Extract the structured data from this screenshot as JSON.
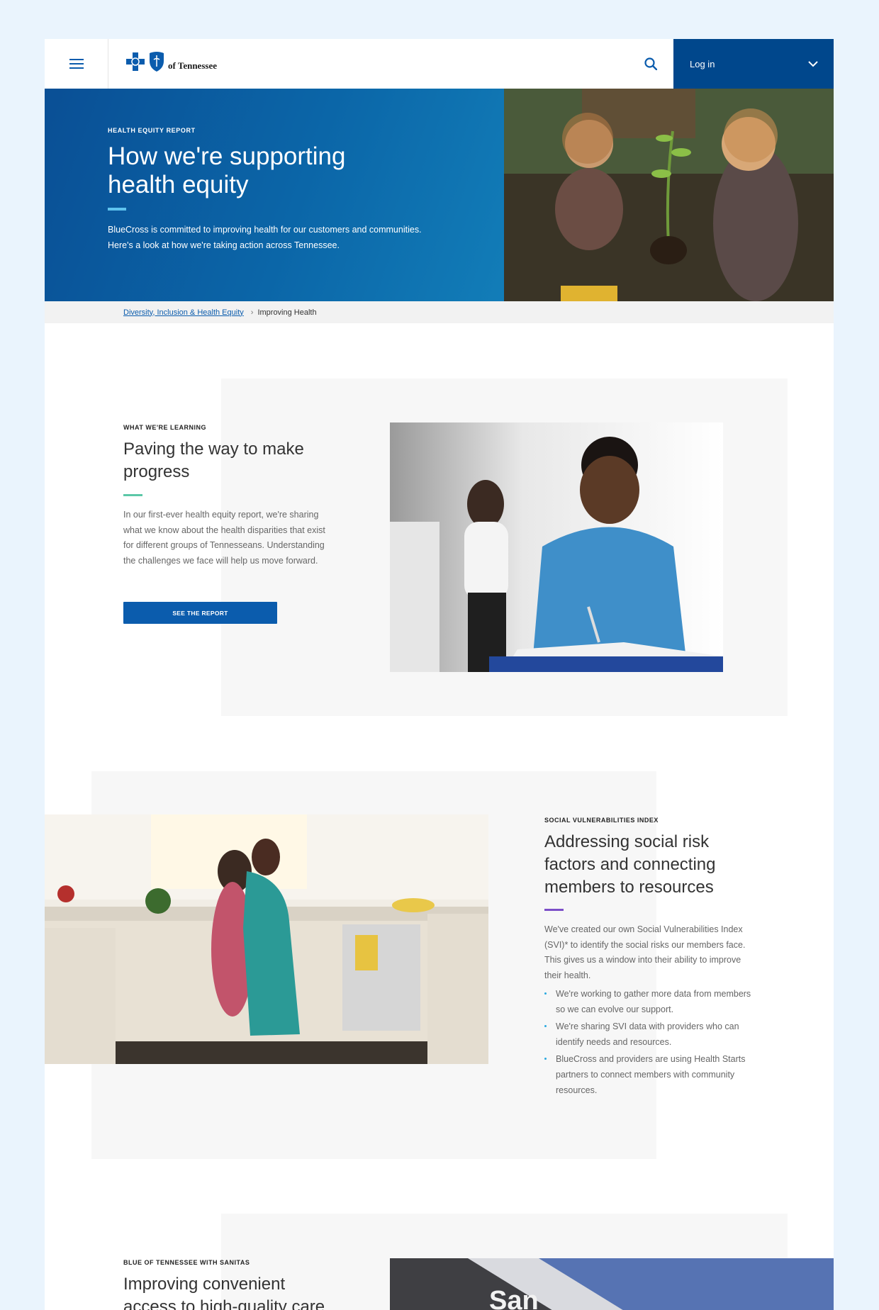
{
  "header": {
    "logo_text": "of Tennessee",
    "login_label": "Log in"
  },
  "hero": {
    "eyebrow": "HEALTH EQUITY REPORT",
    "title": "How we're supporting health equity",
    "description": "BlueCross is committed to improving health for our customers and communities. Here's a look at how we're taking action across Tennessee."
  },
  "breadcrumb": {
    "link": "Diversity, Inclusion & Health Equity",
    "current": "Improving Health"
  },
  "section1": {
    "eyebrow": "WHAT WE'RE LEARNING",
    "title": "Paving the way to make progress",
    "body": "In our first-ever health equity report, we're sharing what we know about the health disparities that exist for different groups of Tennesseans. Understanding the challenges we face will help us move forward.",
    "cta": "SEE THE REPORT"
  },
  "section2": {
    "eyebrow": "SOCIAL VULNERABILITIES INDEX",
    "title": "Addressing social risk factors and connecting members to resources",
    "body": "We've created our own Social Vulnerabilities Index (SVI)* to identify the social risks our members face. This gives us a window into their ability to improve their health.",
    "bullets": [
      "We're working to gather more data from members so we can evolve our support.",
      "We're sharing SVI data with providers who can identify needs and resources.",
      "BlueCross and providers are using Health Starts partners to connect members with community resources."
    ]
  },
  "section3": {
    "eyebrow": "BLUE OF TENNESSEE WITH SANITAS",
    "title": "Improving convenient access to high-quality care"
  },
  "colors": {
    "brand_blue": "#00478c",
    "accent_teal": "#5cc8a7",
    "accent_purple": "#7c4fc8",
    "hero_rule": "#5fc3ee"
  }
}
